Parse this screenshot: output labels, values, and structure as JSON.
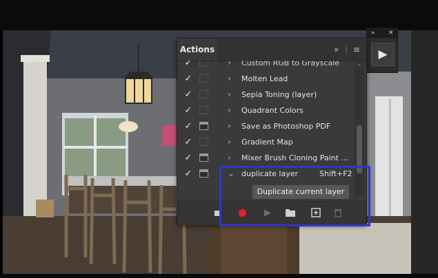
{
  "panel": {
    "title": "Actions",
    "rows": [
      {
        "label": "Custom RGB to Grayscale",
        "checked": true,
        "dialog": false
      },
      {
        "label": "Molten Lead",
        "checked": true,
        "dialog": false
      },
      {
        "label": "Sepia Toning (layer)",
        "checked": true,
        "dialog": false
      },
      {
        "label": "Quadrant Colors",
        "checked": true,
        "dialog": false
      },
      {
        "label": "Save as Photoshop PDF",
        "checked": true,
        "dialog": true
      },
      {
        "label": "Gradient Map",
        "checked": true,
        "dialog": false
      },
      {
        "label": "Mixer Brush Cloning Paint ...",
        "checked": true,
        "dialog": true
      },
      {
        "label": "duplicate layer",
        "shortcut": "Shift+F2",
        "checked": true,
        "dialog": true,
        "expanded": true
      }
    ],
    "sub_step": "Duplicate current layer",
    "icons": {
      "check": "✓",
      "collapsed": "›",
      "expanded": "⌄",
      "menu": "≡",
      "expand_panel": "»"
    },
    "record_color": "#e52424"
  },
  "mini_panel": {
    "play_icon": "▶",
    "expand_icon": "»",
    "close_icon": "✕"
  },
  "highlight_color": "#2f36c9"
}
